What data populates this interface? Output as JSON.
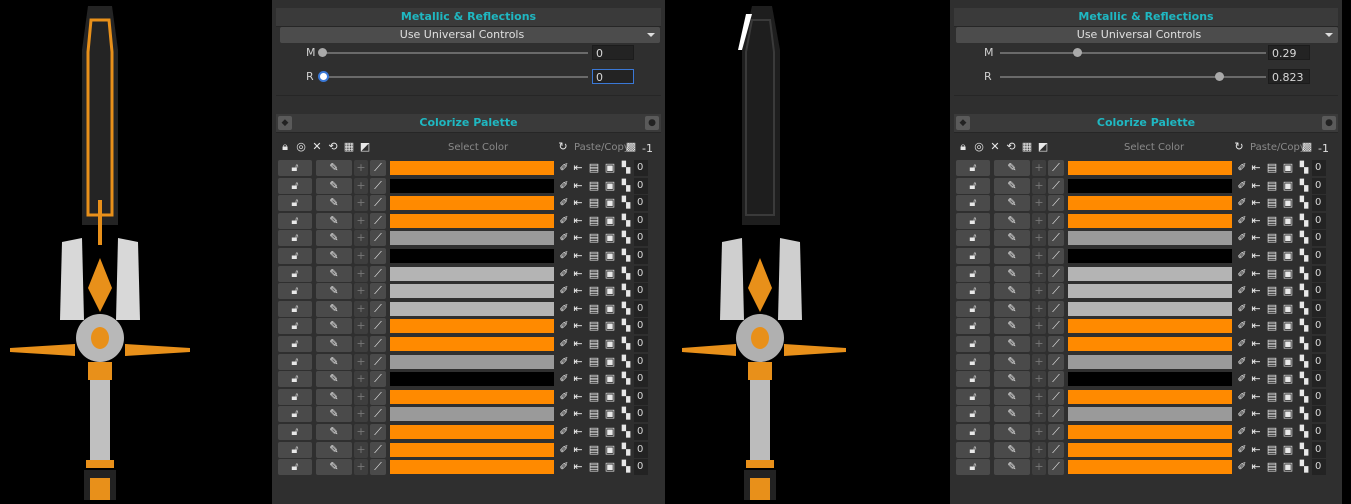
{
  "colors": {
    "orange": "#ff8a00",
    "black": "#000000",
    "gray": "#9a9a9a",
    "lightgray": "#b4b4b4",
    "accent": "#1fb8c2"
  },
  "panels": [
    {
      "metallic": {
        "title": "Metallic & Reflections",
        "dropdown": "Use Universal Controls",
        "m_label": "M",
        "m_value": "0",
        "m_fraction": 0.0,
        "r_label": "R",
        "r_value": "0",
        "r_fraction": 0.0
      },
      "palette": {
        "title": "Colorize Palette",
        "select_color": "Select Color",
        "paste_copy": "Paste/Copy",
        "header_value": "-1"
      },
      "rows": [
        {
          "color": "orange",
          "value": "0"
        },
        {
          "color": "black",
          "value": "0"
        },
        {
          "color": "orange",
          "value": "0"
        },
        {
          "color": "orange",
          "value": "0"
        },
        {
          "color": "gray",
          "value": "0"
        },
        {
          "color": "black",
          "value": "0"
        },
        {
          "color": "lightgray",
          "value": "0"
        },
        {
          "color": "lightgray",
          "value": "0"
        },
        {
          "color": "lightgray",
          "value": "0"
        },
        {
          "color": "orange",
          "value": "0"
        },
        {
          "color": "orange",
          "value": "0"
        },
        {
          "color": "gray",
          "value": "0"
        },
        {
          "color": "black",
          "value": "0"
        },
        {
          "color": "orange",
          "value": "0"
        },
        {
          "color": "gray",
          "value": "0"
        },
        {
          "color": "orange",
          "value": "0"
        },
        {
          "color": "orange",
          "value": "0"
        },
        {
          "color": "orange",
          "value": "0"
        }
      ]
    },
    {
      "metallic": {
        "title": "Metallic & Reflections",
        "dropdown": "Use Universal Controls",
        "m_label": "M",
        "m_value": "0.29",
        "m_fraction": 0.29,
        "r_label": "R",
        "r_value": "0.823",
        "r_fraction": 0.823
      },
      "palette": {
        "title": "Colorize Palette",
        "select_color": "Select Color",
        "paste_copy": "Paste/Copy",
        "header_value": "-1"
      },
      "rows": [
        {
          "color": "orange",
          "value": "0"
        },
        {
          "color": "black",
          "value": "0"
        },
        {
          "color": "orange",
          "value": "0"
        },
        {
          "color": "orange",
          "value": "0"
        },
        {
          "color": "gray",
          "value": "0"
        },
        {
          "color": "black",
          "value": "0"
        },
        {
          "color": "lightgray",
          "value": "0"
        },
        {
          "color": "lightgray",
          "value": "0"
        },
        {
          "color": "lightgray",
          "value": "0"
        },
        {
          "color": "orange",
          "value": "0"
        },
        {
          "color": "orange",
          "value": "0"
        },
        {
          "color": "gray",
          "value": "0"
        },
        {
          "color": "black",
          "value": "0"
        },
        {
          "color": "orange",
          "value": "0"
        },
        {
          "color": "gray",
          "value": "0"
        },
        {
          "color": "orange",
          "value": "0"
        },
        {
          "color": "orange",
          "value": "0"
        },
        {
          "color": "orange",
          "value": "0"
        }
      ]
    }
  ]
}
